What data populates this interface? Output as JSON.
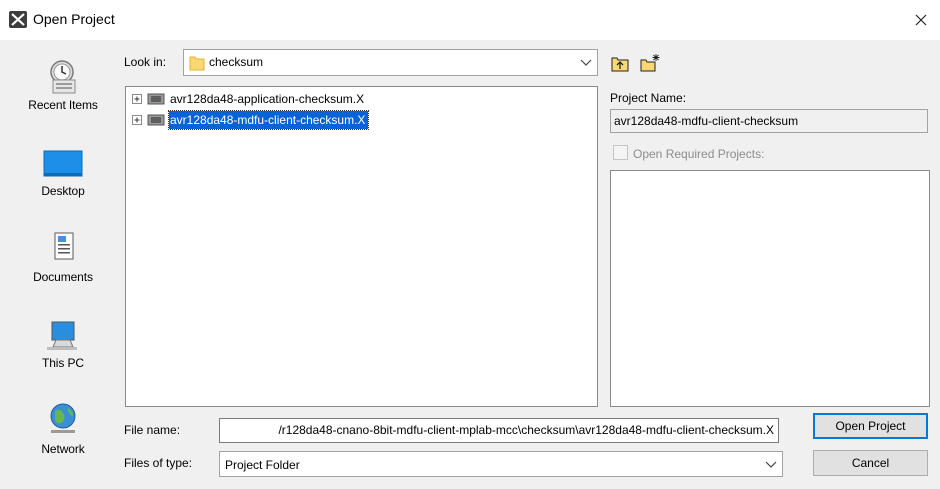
{
  "window": {
    "title": "Open Project"
  },
  "places": [
    {
      "label": "Recent Items",
      "icon": "recent-items-icon"
    },
    {
      "label": "Desktop",
      "icon": "desktop-icon"
    },
    {
      "label": "Documents",
      "icon": "documents-icon"
    },
    {
      "label": "This PC",
      "icon": "this-pc-icon"
    },
    {
      "label": "Network",
      "icon": "network-icon"
    }
  ],
  "look_in": {
    "label": "Look in:",
    "value": "checksum"
  },
  "file_list": [
    {
      "name": "avr128da48-application-checksum.X",
      "selected": false
    },
    {
      "name": "avr128da48-mdfu-client-checksum.X",
      "selected": true
    }
  ],
  "project_name": {
    "label": "Project Name:",
    "value": "avr128da48-mdfu-client-checksum"
  },
  "open_required": {
    "label": "Open Required Projects:",
    "checked": false,
    "enabled": false
  },
  "file_name": {
    "label": "File name:",
    "value": "/r128da48-cnano-8bit-mdfu-client-mplab-mcc\\checksum\\avr128da48-mdfu-client-checksum.X"
  },
  "files_of_type": {
    "label": "Files of type:",
    "value": "Project Folder"
  },
  "buttons": {
    "open": "Open Project",
    "cancel": "Cancel"
  },
  "colors": {
    "selection": "#0a63d6",
    "default_button_border": "#0078d7"
  }
}
